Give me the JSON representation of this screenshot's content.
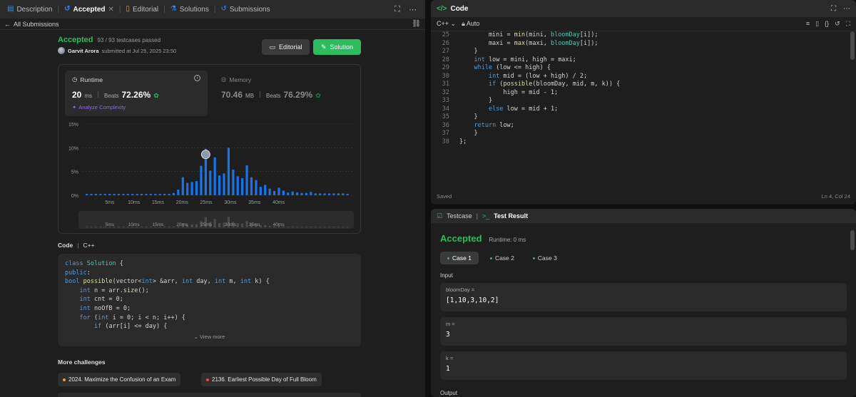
{
  "left_tabs": [
    {
      "label": "Description",
      "icon": "description-icon"
    },
    {
      "label": "Accepted",
      "icon": "history-icon"
    },
    {
      "label": "Editorial",
      "icon": "editorial-icon"
    },
    {
      "label": "Solutions",
      "icon": "flask-icon"
    },
    {
      "label": "Submissions",
      "icon": "history-icon"
    }
  ],
  "nav": {
    "back_label": "All Submissions"
  },
  "submission": {
    "status": "Accepted",
    "testcases": "93 / 93 testcases passed",
    "user": "Garvit Arora",
    "submitted_at": "submitted at Jul 25, 2025 23:50",
    "editorial_btn": "Editorial",
    "solution_btn": "Solution"
  },
  "runtime": {
    "title": "Runtime",
    "value": "20",
    "unit": "ms",
    "beats_label": "Beats",
    "beats": "72.26%",
    "analyze": "Analyze Complexity"
  },
  "memory": {
    "title": "Memory",
    "value": "70.46",
    "unit": "MB",
    "beats_label": "Beats",
    "beats": "76.29%"
  },
  "chart_data": {
    "type": "bar",
    "title": "",
    "xlabel": "",
    "ylabel": "",
    "ylim": [
      0,
      15
    ],
    "yticks": [
      "0%",
      "5%",
      "10%",
      "15%"
    ],
    "x_tick_labels": [
      "5ms",
      "10ms",
      "15ms",
      "20ms",
      "25ms",
      "30ms",
      "35ms",
      "40ms"
    ],
    "values": [
      0.3,
      0.3,
      0.3,
      0.3,
      0.3,
      0.3,
      0.3,
      0.3,
      0.3,
      0.3,
      0.3,
      0.3,
      0.3,
      0.3,
      0.3,
      0.3,
      0.3,
      0.3,
      0.3,
      0.5,
      1.2,
      3.8,
      2.6,
      2.8,
      3.0,
      6.2,
      9.8,
      5.2,
      8.0,
      4.2,
      4.6,
      10.0,
      5.4,
      4.0,
      3.6,
      6.3,
      3.8,
      3.2,
      1.8,
      2.2,
      1.4,
      0.9,
      1.6,
      1.0,
      0.6,
      0.8,
      0.6,
      0.5,
      0.5,
      0.7,
      0.4,
      0.4,
      0.4,
      0.4,
      0.4,
      0.4,
      0.4,
      0.3
    ],
    "highlight_index": 26,
    "grid": true
  },
  "code_section": {
    "label": "Code",
    "lang": "C++",
    "view_more": "View more"
  },
  "code_lines": [
    "class Solution {",
    "public:",
    "bool possible(vector<int> &arr, int day, int m, int k) {",
    "    int n = arr.size();",
    "    int cnt = 0;",
    "    int noOfB = 0;",
    "    for (int i = 0; i < n; i++) {",
    "        if (arr[i] <= day) {"
  ],
  "more": {
    "title": "More challenges",
    "items": [
      {
        "label": "2024. Maximize the Confusion of an Exam",
        "color": "#e8a23c"
      },
      {
        "label": "2136. Earliest Possible Day of Full Bloom",
        "color": "#ef4743"
      }
    ]
  },
  "code_panel": {
    "title": "Code",
    "lang": "C++",
    "mode": "Auto",
    "saved": "Saved",
    "position": "Ln 4, Col 24",
    "lines": [
      {
        "n": "25",
        "t": "        mini = min(mini, bloomDay[i]);"
      },
      {
        "n": "26",
        "t": "        maxi = max(maxi, bloomDay[i]);"
      },
      {
        "n": "27",
        "t": "    }"
      },
      {
        "n": "28",
        "t": "    int low = mini, high = maxi;"
      },
      {
        "n": "29",
        "t": "    while (low <= high) {"
      },
      {
        "n": "30",
        "t": "        int mid = (low + high) / 2;"
      },
      {
        "n": "31",
        "t": "        if (possible(bloomDay, mid, m, k)) {"
      },
      {
        "n": "32",
        "t": "            high = mid - 1;"
      },
      {
        "n": "33",
        "t": "        }"
      },
      {
        "n": "34",
        "t": "        else low = mid + 1;"
      },
      {
        "n": "35",
        "t": "    }"
      },
      {
        "n": "36",
        "t": "    return low;"
      },
      {
        "n": "37",
        "t": "    }"
      },
      {
        "n": "38",
        "t": "};"
      }
    ]
  },
  "test_panel": {
    "tab_testcase": "Testcase",
    "tab_result": "Test Result",
    "status": "Accepted",
    "runtime": "Runtime: 0 ms",
    "cases": [
      "Case 1",
      "Case 2",
      "Case 3"
    ],
    "input_label": "Input",
    "fields": [
      {
        "name": "bloomDay =",
        "value": "[1,10,3,10,2]"
      },
      {
        "name": "m =",
        "value": "3"
      },
      {
        "name": "k =",
        "value": "1"
      }
    ],
    "output_label": "Output"
  },
  "colors": {
    "accent_green": "#2cbb5d",
    "bar_blue": "#1a73e8",
    "panel_bg": "#1e1e1e"
  }
}
